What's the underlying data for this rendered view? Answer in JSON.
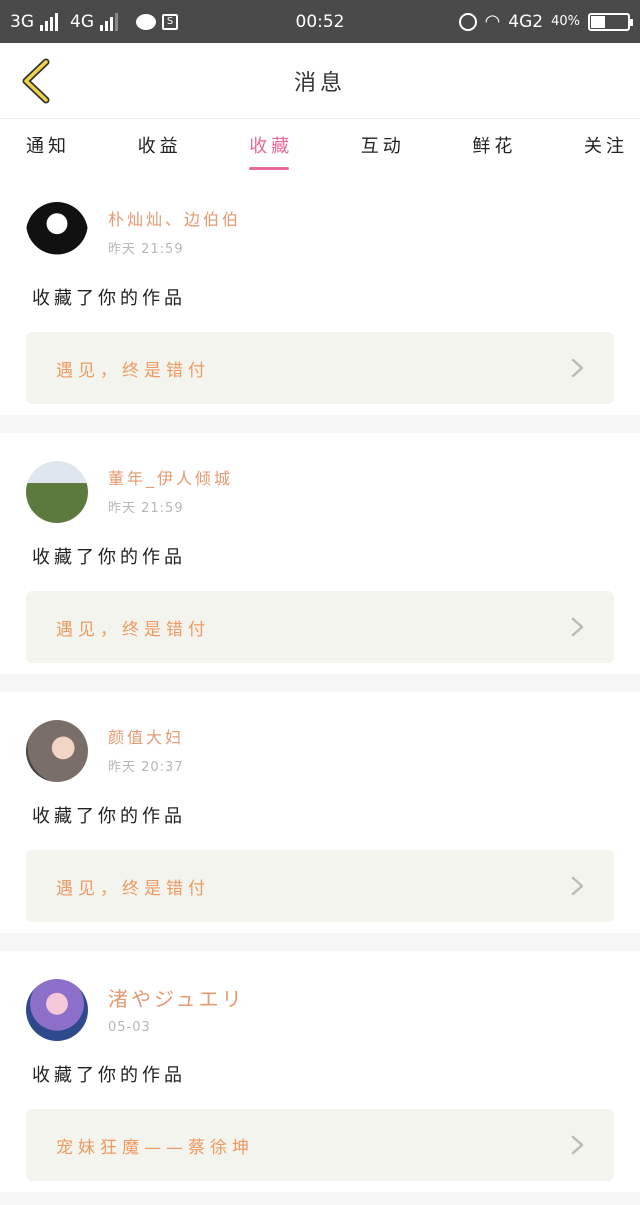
{
  "status_bar": {
    "net1": "3G",
    "net2": "4G",
    "time": "00:52",
    "net3": "4G2",
    "battery": "40%"
  },
  "header": {
    "title": "消息"
  },
  "tabs": [
    {
      "label": "通知",
      "active": false
    },
    {
      "label": "收益",
      "active": false
    },
    {
      "label": "收藏",
      "active": true
    },
    {
      "label": "互动",
      "active": false
    },
    {
      "label": "鲜花",
      "active": false
    },
    {
      "label": "关注",
      "active": false
    }
  ],
  "messages": [
    {
      "name": "朴灿灿、边伯伯",
      "time": "昨天 21:59",
      "action": "收藏了你的作品",
      "work": "遇见，终是错付"
    },
    {
      "name": "董年_伊人倾城",
      "time": "昨天 21:59",
      "action": "收藏了你的作品",
      "work": "遇见，终是错付"
    },
    {
      "name": "颜值大妇",
      "time": "昨天 20:37",
      "action": "收藏了你的作品",
      "work": "遇见，终是错付"
    },
    {
      "name": "渚やジュエリ",
      "time": "05-03",
      "action": "收藏了你的作品",
      "work": "宠妹狂魔——蔡徐坤"
    }
  ],
  "colors": {
    "accent": "#e86a9a",
    "name": "#e49a72",
    "work_title": "#ec9a62",
    "status_bar": "#4a4a4a"
  }
}
